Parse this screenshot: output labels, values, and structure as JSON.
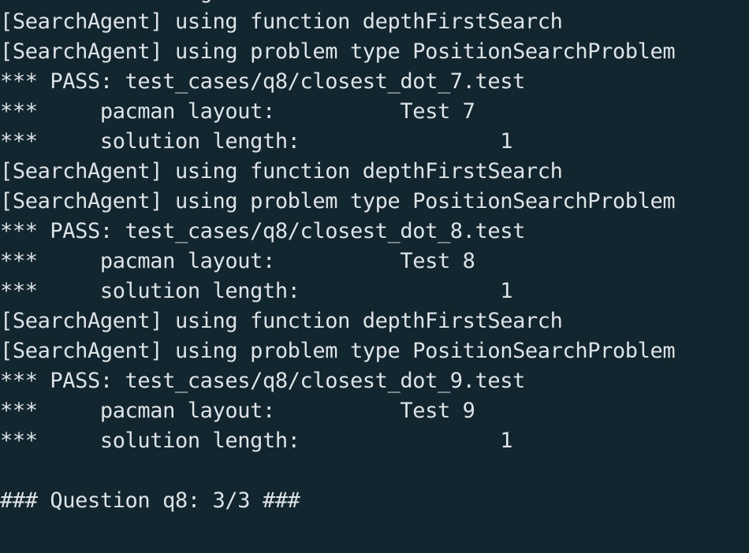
{
  "terminal": {
    "background": "#11262f",
    "foreground": "#dfe3e4",
    "lines": [
      "*** solution length:",
      "[SearchAgent] using function depthFirstSearch",
      "[SearchAgent] using problem type PositionSearchProblem",
      "*** PASS: test_cases/q8/closest_dot_7.test",
      "***     pacman layout:          Test 7",
      "***     solution length:                1",
      "[SearchAgent] using function depthFirstSearch",
      "[SearchAgent] using problem type PositionSearchProblem",
      "*** PASS: test_cases/q8/closest_dot_8.test",
      "***     pacman layout:          Test 8",
      "***     solution length:                1",
      "[SearchAgent] using function depthFirstSearch",
      "[SearchAgent] using problem type PositionSearchProblem",
      "*** PASS: test_cases/q8/closest_dot_9.test",
      "***     pacman layout:          Test 9",
      "***     solution length:                1",
      "",
      "### Question q8: 3/3 ###",
      ""
    ]
  }
}
